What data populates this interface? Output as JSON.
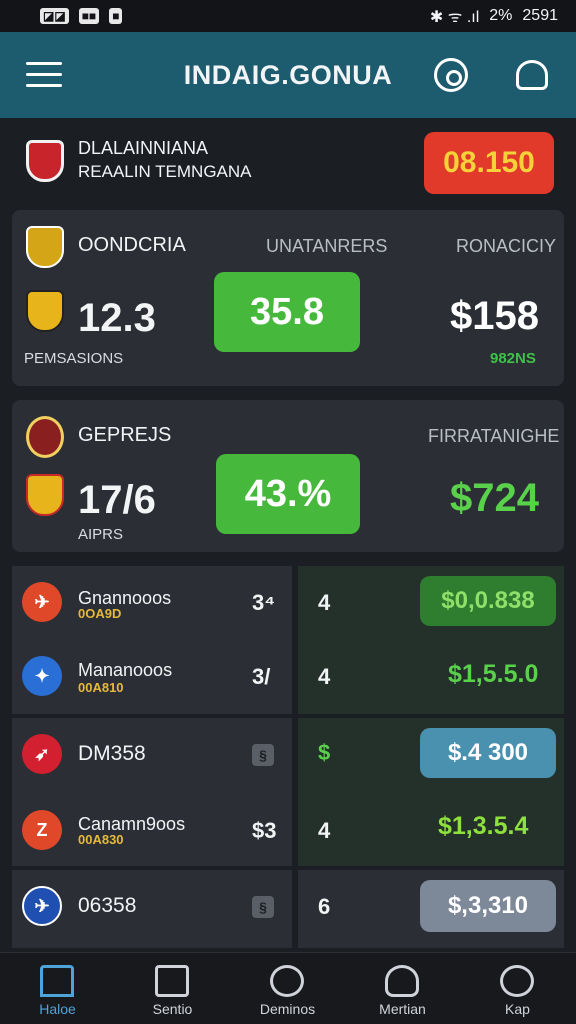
{
  "status_bar": {
    "left_icons": [
      "◪◪",
      "■■",
      "■"
    ],
    "signal": "✱ ᯤ .ıl",
    "battery": "2%",
    "time": "2591"
  },
  "app_bar": {
    "title": "INDAIG.GONUA",
    "icons": [
      "menu-icon",
      "search-icon",
      "refresh-icon"
    ]
  },
  "header": {
    "line1": "DLALAINNIANA",
    "line2": "REAALIN TEMNGANA",
    "badge": "08.150",
    "badge_color": "#e23a2a"
  },
  "cards": [
    {
      "team": "OONDCRIA",
      "col_mid": "UNATANRERS",
      "col_right": "RONACICIY",
      "score": "12.3",
      "sublabel": "PEMSASIONS",
      "pill": "35.8",
      "amount": "$158",
      "amount_color": "#ffffff",
      "note": "982NS",
      "note_color": "#3fc04a"
    },
    {
      "team": "GEPREJS",
      "col_mid": "",
      "col_right": "FIRRATANIGHE",
      "score": "17/6",
      "sublabel": "AIPRS",
      "pill": "43.%",
      "amount": "$724",
      "amount_color": "#5ad14a",
      "note": "",
      "note_color": "#3fc04a"
    }
  ],
  "rows": [
    {
      "name": "Gnannooos",
      "code": "0OA9D",
      "num1": "3⁴",
      "num2": "4",
      "value": "$0,0.838",
      "value_style": "pill-green",
      "icon_color": "#e0482a"
    },
    {
      "name": "Mananooos",
      "code": "00A810",
      "num1": "3/",
      "num2": "4",
      "value": "$1,5.5.0",
      "value_style": "text-green",
      "icon_color": "#2a6fd6"
    },
    {
      "name": "DM358",
      "code": "",
      "num1": "§",
      "num2": "$",
      "value": "$.4 300",
      "value_style": "pill-blue",
      "icon_color": "#d32030"
    },
    {
      "name": "Canamn9oos",
      "code": "00A830",
      "num1": "$3",
      "num2": "4",
      "value": "$1,3.5.4",
      "value_style": "text-lime",
      "icon_color": "#e0482a"
    },
    {
      "name": "06358",
      "code": "",
      "num1": "§",
      "num2": "6",
      "value": "$,3,310",
      "value_style": "pill-gray",
      "icon_color": "#1f4fb0"
    }
  ],
  "bottom_nav": [
    {
      "label": "Haloe",
      "icon": "home-icon",
      "active": true
    },
    {
      "label": "Sentio",
      "icon": "calendar-icon",
      "active": false
    },
    {
      "label": "Deminos",
      "icon": "ball-icon",
      "active": false
    },
    {
      "label": "Mertian",
      "icon": "headset-icon",
      "active": false
    },
    {
      "label": "Kap",
      "icon": "gauge-icon",
      "active": false
    }
  ],
  "colors": {
    "accent": "#1d5c6e",
    "green": "#46b93c",
    "red": "#e23a2a"
  }
}
